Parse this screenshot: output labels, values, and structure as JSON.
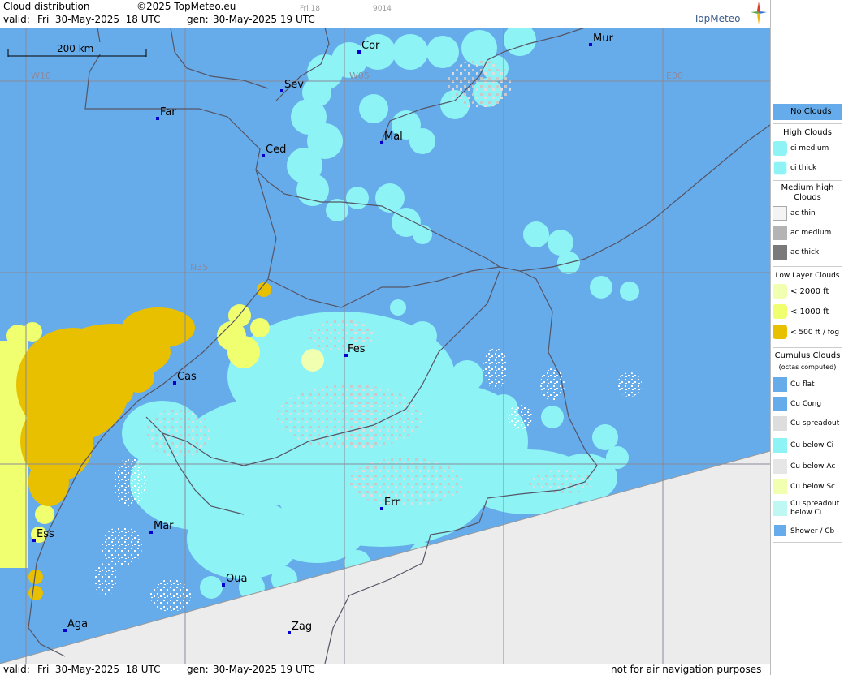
{
  "header": {
    "title": "Cloud distribution",
    "copyright": "©2025 TopMeteo.eu",
    "small_day": "Fri 18",
    "small_code": "9014",
    "valid_label": "valid:",
    "valid_value": "Fri  30-May-2025  18 UTC",
    "gen_label": "gen:",
    "gen_value": "30-May-2025 19 UTC"
  },
  "logo": {
    "text": "TopMeteo"
  },
  "footer": {
    "valid_label": "valid:",
    "valid_value": "Fri  30-May-2025  18 UTC",
    "gen_label": "gen:",
    "gen_value": "30-May-2025 19 UTC",
    "disclaimer": "not for air navigation purposes"
  },
  "map": {
    "scale_label": "200 km",
    "grid_labels": {
      "w10": "W10",
      "w05": "W05",
      "e00": "E00",
      "n35": "N35"
    },
    "cities": [
      {
        "name": "Cor"
      },
      {
        "name": "Mur"
      },
      {
        "name": "Sev"
      },
      {
        "name": "Far"
      },
      {
        "name": "Mal"
      },
      {
        "name": "Ced"
      },
      {
        "name": "Fes"
      },
      {
        "name": "Cas"
      },
      {
        "name": "Err"
      },
      {
        "name": "Mar"
      },
      {
        "name": "Ess"
      },
      {
        "name": "Oua"
      },
      {
        "name": "Aga"
      },
      {
        "name": "Zag"
      }
    ],
    "colors": {
      "no_clouds": "#66acea",
      "ci": "#8ef3f5",
      "low_yellow": "#e8c000",
      "low_light": "#f0ff70",
      "fog": "#f0ffb0",
      "outside": "#ececec",
      "border": "#555566"
    }
  },
  "legend": {
    "no_clouds": "No Clouds",
    "high_clouds": "High Clouds",
    "ci_medium": "ci medium",
    "ci_thick": "ci thick",
    "medium_high": "Medium high Clouds",
    "ac_thin": "ac thin",
    "ac_medium": "ac medium",
    "ac_thick": "ac thick",
    "low_layer": "Low Layer Clouds",
    "lt_2000": "< 2000 ft",
    "lt_1000": "< 1000 ft",
    "lt_500": "< 500 ft / fog",
    "cumulus": "Cumulus Clouds",
    "cumulus_note": "(octas computed)",
    "cu_flat": "Cu flat",
    "cu_cong": "Cu Cong",
    "cu_spreadout": "Cu spreadout",
    "cu_below_ci": "Cu below Ci",
    "cu_below_ac": "Cu below Ac",
    "cu_below_sc": "Cu below Sc",
    "cu_spreadout_below_ci": "Cu spreadout below Ci",
    "shower_cb": "Shower / Cb"
  }
}
